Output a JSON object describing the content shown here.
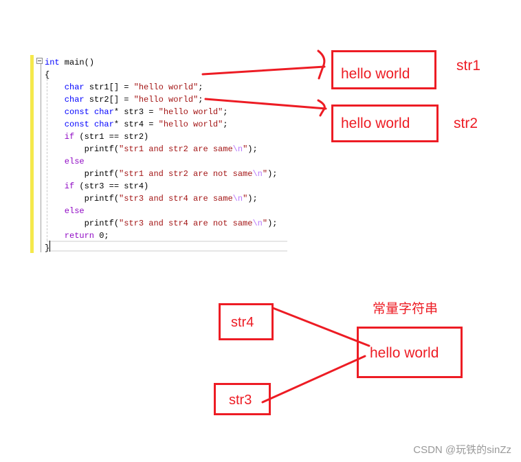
{
  "code": {
    "lines": [
      [
        {
          "t": "int",
          "c": "kw"
        },
        {
          "t": " main()",
          "c": "id"
        }
      ],
      [
        {
          "t": "{",
          "c": "id"
        }
      ],
      [
        {
          "t": "    char",
          "c": "kw"
        },
        {
          "t": " str1[] = ",
          "c": "id"
        },
        {
          "t": "\"hello world\"",
          "c": "str"
        },
        {
          "t": ";",
          "c": "id"
        }
      ],
      [
        {
          "t": "    char",
          "c": "kw"
        },
        {
          "t": " str2[] = ",
          "c": "id"
        },
        {
          "t": "\"hello world\"",
          "c": "str"
        },
        {
          "t": ";",
          "c": "id"
        }
      ],
      [
        {
          "t": "    const char",
          "c": "kw"
        },
        {
          "t": "* str3 = ",
          "c": "id"
        },
        {
          "t": "\"hello world\"",
          "c": "str"
        },
        {
          "t": ";",
          "c": "id"
        }
      ],
      [
        {
          "t": "    const char",
          "c": "kw"
        },
        {
          "t": "* str4 = ",
          "c": "id"
        },
        {
          "t": "\"hello world\"",
          "c": "str"
        },
        {
          "t": ";",
          "c": "id"
        }
      ],
      [
        {
          "t": "    if",
          "c": "ctl"
        },
        {
          "t": " (str1 == str2)",
          "c": "id"
        }
      ],
      [
        {
          "t": "        printf(",
          "c": "id"
        },
        {
          "t": "\"str1 and str2 are same",
          "c": "str"
        },
        {
          "t": "\\n",
          "c": "esc"
        },
        {
          "t": "\"",
          "c": "str"
        },
        {
          "t": ");",
          "c": "id"
        }
      ],
      [
        {
          "t": "    else",
          "c": "ctl"
        }
      ],
      [
        {
          "t": "        printf(",
          "c": "id"
        },
        {
          "t": "\"str1 and str2 are not same",
          "c": "str"
        },
        {
          "t": "\\n",
          "c": "esc"
        },
        {
          "t": "\"",
          "c": "str"
        },
        {
          "t": ");",
          "c": "id"
        }
      ],
      [
        {
          "t": "    if",
          "c": "ctl"
        },
        {
          "t": " (str3 == str4)",
          "c": "id"
        }
      ],
      [
        {
          "t": "        printf(",
          "c": "id"
        },
        {
          "t": "\"str3 and str4 are same",
          "c": "str"
        },
        {
          "t": "\\n",
          "c": "esc"
        },
        {
          "t": "\"",
          "c": "str"
        },
        {
          "t": ");",
          "c": "id"
        }
      ],
      [
        {
          "t": "    else",
          "c": "ctl"
        }
      ],
      [
        {
          "t": "        printf(",
          "c": "id"
        },
        {
          "t": "\"str3 and str4 are not same",
          "c": "str"
        },
        {
          "t": "\\n",
          "c": "esc"
        },
        {
          "t": "\"",
          "c": "str"
        },
        {
          "t": ");",
          "c": "id"
        }
      ],
      [
        {
          "t": "    return",
          "c": "ctl"
        },
        {
          "t": " 0;",
          "c": "id"
        }
      ],
      [
        {
          "t": "}",
          "c": "id"
        }
      ]
    ]
  },
  "diagram": {
    "box1_text": "hello world",
    "box2_text": "hello world",
    "label_str1": "str1",
    "label_str2": "str2",
    "const_label": "常量字符串",
    "shared_text": "hello world",
    "str4": "str4",
    "str3": "str3",
    "color": "#ed1c24"
  },
  "watermark": "CSDN @玩铁的sinZz"
}
